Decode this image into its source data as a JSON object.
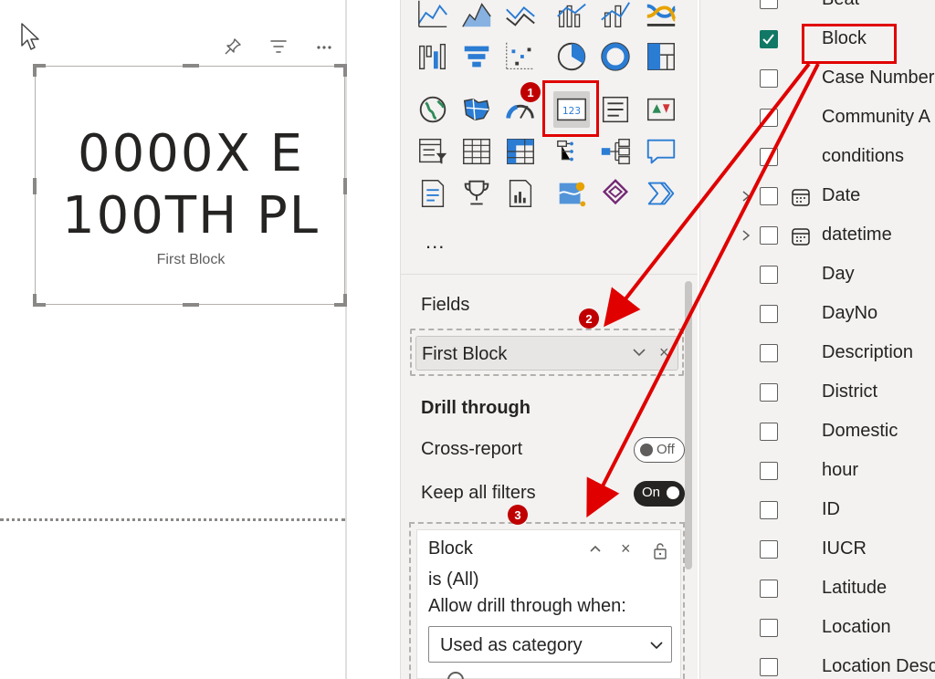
{
  "card": {
    "value": "0000X E\n100TH PL",
    "label": "First Block"
  },
  "visualizations": {
    "more": "...",
    "icons": [
      "line-chart-icon",
      "area-chart-icon",
      "stacked-area-chart-icon",
      "line-clustered-column-icon",
      "line-stacked-column-icon",
      "ribbon-chart-icon",
      "waterfall-chart-icon",
      "funnel-chart-icon",
      "scatter-chart-icon",
      "pie-chart-icon",
      "donut-chart-icon",
      "treemap-icon",
      "map-icon",
      "filled-map-icon",
      "gauge-icon",
      "card-icon",
      "multi-row-card-icon",
      "kpi-icon",
      "slicer-icon",
      "table-icon",
      "matrix-icon",
      "decomposition-tree-icon",
      "key-influencers-icon",
      "qa-icon",
      "smart-narrative-icon",
      "goals-icon",
      "paginated-report-icon",
      "azure-map-icon",
      "power-apps-icon",
      "power-automate-icon"
    ]
  },
  "fields": {
    "title": "Fields",
    "pill_label": "First Block",
    "pill_close": "×"
  },
  "drillthrough": {
    "title": "Drill through",
    "cross_report": "Cross-report",
    "cross_report_state": "Off",
    "keep_filters": "Keep all filters",
    "keep_filters_state": "On",
    "filter_field": "Block",
    "filter_close": "×",
    "filter_summary": "is (All)",
    "allow_label": "Allow drill through when:",
    "allow_value": "Used as category"
  },
  "field_list": [
    {
      "name": "Beat",
      "checked": false,
      "expandable": false,
      "calendar": false
    },
    {
      "name": "Block",
      "checked": true,
      "expandable": false,
      "calendar": false
    },
    {
      "name": "Case Number",
      "checked": false,
      "expandable": false,
      "calendar": false
    },
    {
      "name": "Community A",
      "checked": false,
      "expandable": false,
      "calendar": false
    },
    {
      "name": "conditions",
      "checked": false,
      "expandable": false,
      "calendar": false
    },
    {
      "name": "Date",
      "checked": false,
      "expandable": true,
      "calendar": true
    },
    {
      "name": "datetime",
      "checked": false,
      "expandable": true,
      "calendar": true
    },
    {
      "name": "Day",
      "checked": false,
      "expandable": false,
      "calendar": false
    },
    {
      "name": "DayNo",
      "checked": false,
      "expandable": false,
      "calendar": false
    },
    {
      "name": "Description",
      "checked": false,
      "expandable": false,
      "calendar": false
    },
    {
      "name": "District",
      "checked": false,
      "expandable": false,
      "calendar": false
    },
    {
      "name": "Domestic",
      "checked": false,
      "expandable": false,
      "calendar": false
    },
    {
      "name": "hour",
      "checked": false,
      "expandable": false,
      "calendar": false
    },
    {
      "name": "ID",
      "checked": false,
      "expandable": false,
      "calendar": false
    },
    {
      "name": "IUCR",
      "checked": false,
      "expandable": false,
      "calendar": false
    },
    {
      "name": "Latitude",
      "checked": false,
      "expandable": false,
      "calendar": false
    },
    {
      "name": "Location",
      "checked": false,
      "expandable": false,
      "calendar": false
    },
    {
      "name": "Location Desc",
      "checked": false,
      "expandable": false,
      "calendar": false
    }
  ],
  "annotations": {
    "badge1": "1",
    "badge2": "2",
    "badge3": "3",
    "color": "#e00000"
  },
  "colors": {
    "accent_teal": "#117865",
    "pane_bg": "#f3f2f1",
    "annotation_red": "#e00000"
  }
}
